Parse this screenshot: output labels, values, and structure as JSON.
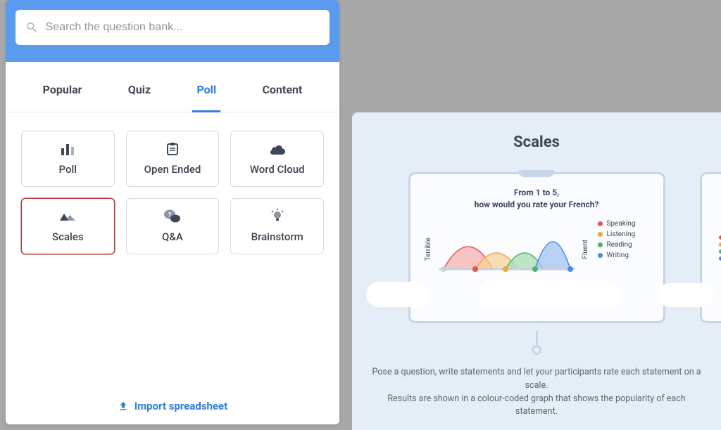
{
  "search": {
    "placeholder": "Search the question bank..."
  },
  "tabs": {
    "0": {
      "label": "Popular"
    },
    "1": {
      "label": "Quiz"
    },
    "2": {
      "label": "Poll"
    },
    "3": {
      "label": "Content"
    }
  },
  "cards": {
    "0": {
      "label": "Poll"
    },
    "1": {
      "label": "Open Ended"
    },
    "2": {
      "label": "Word Cloud"
    },
    "3": {
      "label": "Scales"
    },
    "4": {
      "label": "Q&A"
    },
    "5": {
      "label": "Brainstorm"
    }
  },
  "import": {
    "label": "Import spreadsheet"
  },
  "preview": {
    "title": "Scales",
    "question_line1": "From 1 to 5,",
    "question_line2": "how would you rate your French?",
    "axis_left": "Terrible",
    "axis_right": "Fluent",
    "legend": {
      "0": {
        "label": "Speaking",
        "color": "#e4554f"
      },
      "1": {
        "label": "Listening",
        "color": "#f0a83c"
      },
      "2": {
        "label": "Reading",
        "color": "#4fb36e"
      },
      "3": {
        "label": "Writing",
        "color": "#4b89e8"
      }
    },
    "description_line1": "Pose a question, write statements and let your participants rate each statement on a scale.",
    "description_line2": "Results are shown in a colour-coded graph that shows the popularity of each statement."
  },
  "chart_data": {
    "type": "area",
    "title": "From 1 to 5, how would you rate your French?",
    "xlabel_left": "Terrible",
    "xlabel_right": "Fluent",
    "x_range": [
      1,
      5
    ],
    "series": [
      {
        "name": "Speaking",
        "peak_x": 2,
        "peak_height": 0.75,
        "color": "#e4554f"
      },
      {
        "name": "Listening",
        "peak_x": 3,
        "peak_height": 0.55,
        "color": "#f0a83c"
      },
      {
        "name": "Reading",
        "peak_x": 3.7,
        "peak_height": 0.55,
        "color": "#4fb36e"
      },
      {
        "name": "Writing",
        "peak_x": 4.5,
        "peak_height": 1.0,
        "color": "#4b89e8"
      }
    ]
  }
}
